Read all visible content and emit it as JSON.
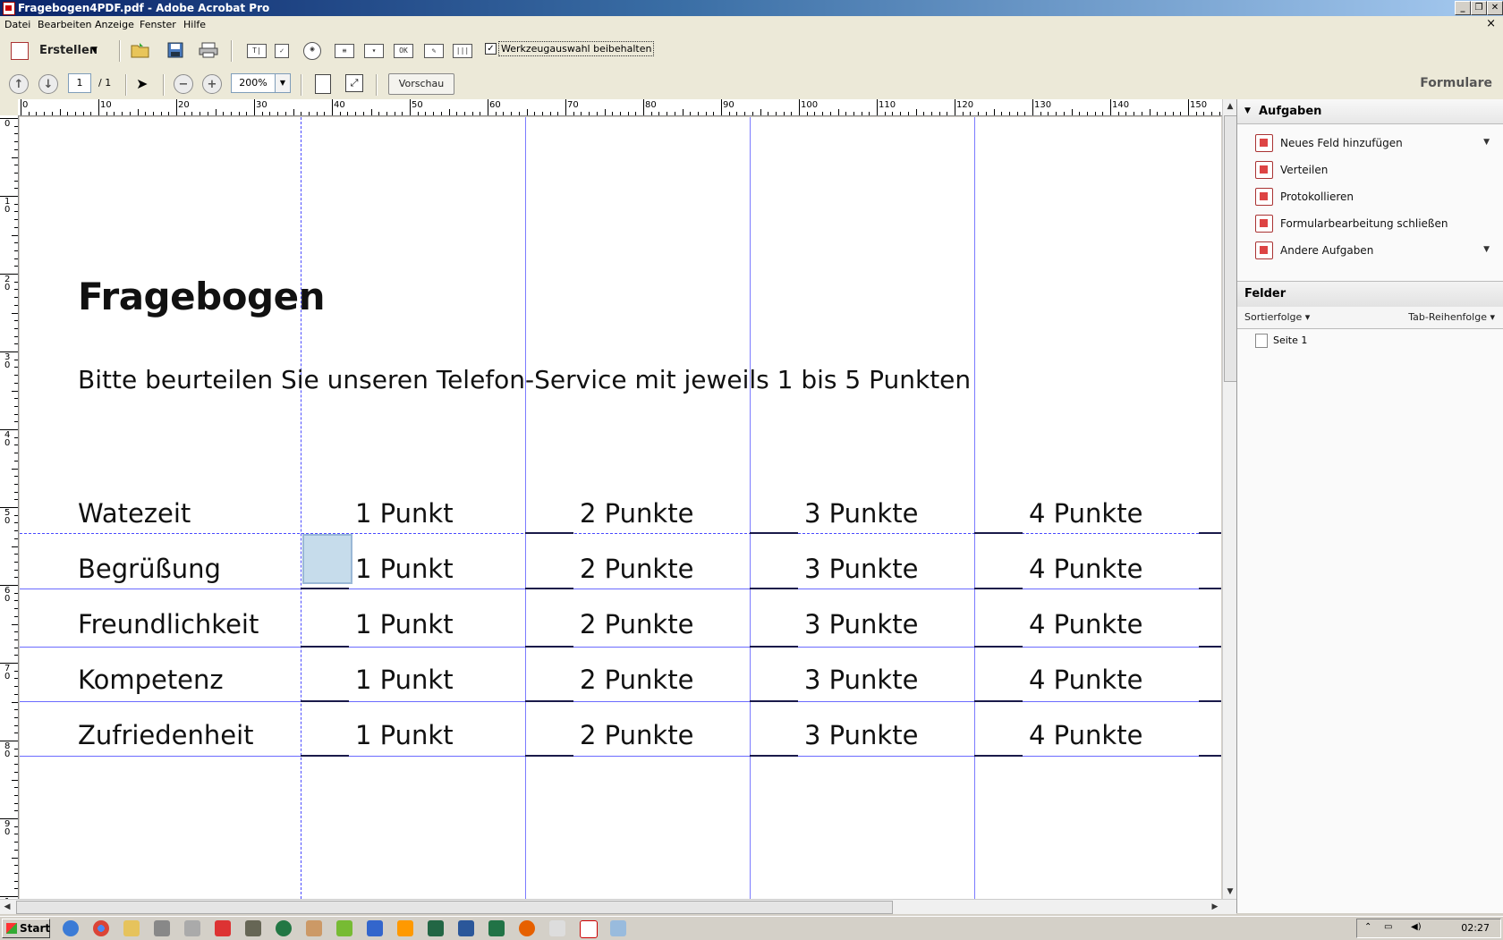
{
  "window": {
    "title": "Fragebogen4PDF.pdf - Adobe Acrobat Pro",
    "controls": [
      "minimize-icon",
      "restore-icon",
      "close-icon"
    ]
  },
  "menu": {
    "items": [
      "Datei",
      "Bearbeiten",
      "Anzeige",
      "Fenster",
      "Hilfe"
    ],
    "close_glyph": "×"
  },
  "toolbar": {
    "erstellen_label": "Erstellen",
    "keep_tool_label": "Werkzeugauswahl beibehalten",
    "keep_tool_checked": true,
    "field_tool_icons": [
      "text-field-icon",
      "checkbox-field-icon",
      "radio-button-icon",
      "listbox-icon",
      "dropdown-icon",
      "button-field-icon",
      "digital-signature-icon",
      "barcode-icon"
    ]
  },
  "nav": {
    "page_current": "1",
    "page_total": "/ 1",
    "zoom": "200%",
    "preview_label": "Vorschau",
    "mode_label": "Formulare"
  },
  "ruler": {
    "h_labels": [
      "0",
      "10",
      "20",
      "30",
      "40",
      "50",
      "60",
      "70",
      "80",
      "90",
      "100",
      "110",
      "120",
      "130",
      "140",
      "150"
    ],
    "v_labels": [
      "0",
      "10",
      "20",
      "30",
      "40",
      "50",
      "60",
      "70",
      "80",
      "90",
      "10"
    ]
  },
  "document": {
    "title": "Fragebogen",
    "subtitle": "Bitte beurteilen Sie unseren Telefon-Service mit jeweils 1 bis 5 Punkten",
    "rows": [
      {
        "label": "Watezeit",
        "cells": [
          "1 Punkt",
          "2 Punkte",
          "3 Punkte",
          "4 Punkte"
        ]
      },
      {
        "label": "Begrüßung",
        "cells": [
          "1 Punkt",
          "2 Punkte",
          "3 Punkte",
          "4 Punkte"
        ]
      },
      {
        "label": "Freundlichkeit",
        "cells": [
          "1 Punkt",
          "2 Punkte",
          "3 Punkte",
          "4 Punkte"
        ]
      },
      {
        "label": "Kompetenz",
        "cells": [
          "1 Punkt",
          "2 Punkte",
          "3 Punkte",
          "4 Punkte"
        ]
      },
      {
        "label": "Zufriedenheit",
        "cells": [
          "1 Punkt",
          "2 Punkte",
          "3 Punkte",
          "4 Punkte"
        ]
      }
    ]
  },
  "panel": {
    "aufgaben_title": "Aufgaben",
    "tasks": [
      {
        "label": "Neues Feld hinzufügen",
        "icon": "add-field-icon",
        "has_dropdown": true
      },
      {
        "label": "Verteilen",
        "icon": "distribute-icon",
        "has_dropdown": false
      },
      {
        "label": "Protokollieren",
        "icon": "track-icon",
        "has_dropdown": false
      },
      {
        "label": "Formularbearbeitung schließen",
        "icon": "close-form-edit-icon",
        "has_dropdown": false
      },
      {
        "label": "Andere Aufgaben",
        "icon": "other-tasks-icon",
        "has_dropdown": true
      }
    ],
    "felder_title": "Felder",
    "sort_label": "Sortierfolge",
    "tab_order_label": "Tab-Reihenfolge",
    "tree_item": "Seite 1"
  },
  "taskbar": {
    "start_label": "Start",
    "clock": "02:27"
  }
}
